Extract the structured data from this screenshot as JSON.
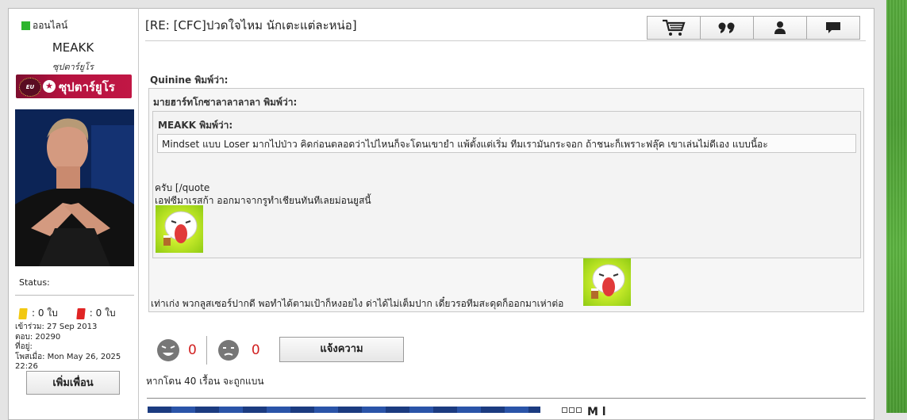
{
  "user": {
    "online_label": "ออนไลน์",
    "username": "MEAKK",
    "rank_title": "ซุปตาร์ยูโร",
    "badge": {
      "emblem": "EU",
      "text": "ซุปตาร์ยูโร"
    },
    "status_label": "Status:",
    "yellow_cards": ": 0 ใบ",
    "red_cards": ": 0 ใบ",
    "joined": "เข้าร่วม: 27 Sep 2013",
    "replies": "ตอบ: 20290",
    "location": "ที่อยู่:",
    "last_post": "โพสเมื่อ: Mon May 26, 2025 22:26",
    "add_friend_label": "เพิ่มเพื่อน"
  },
  "post": {
    "title": "[RE: [CFC]ปวดใจไหม นักเตะแต่ละหน่อ]",
    "toolbar": [
      "cart-icon",
      "quote-icon",
      "user-icon",
      "message-icon"
    ],
    "outer_quote": {
      "author": "Quinine พิมพ์ว่า:",
      "body": "เท่าเก่ง พวกลูสเซอร์ปากดี พอทำได้ตามเป้าก็หงอยไง ด่าได้ไม่เต็มปาก เดี๋ยวรอทีมสะดุดก็ออกมาเห่าต่อ"
    },
    "mid_quote": {
      "author": "มายฮาร์ทโกซาลาลาลาลา พิมพ์ว่า:",
      "line1": "ครับ [/quote",
      "line2": "เอฟซีมาเรสก้า ออกมาจากรูทำเชียนทันทีเลยม่อนยูสนี้"
    },
    "inner_quote": {
      "author": "MEAKK พิมพ์ว่า:",
      "body": "Mindset แบบ Loser มากไปป่าว คิดก่อนตลอดว่าไปไหนก็จะโดนเขายำ แพ้ตั้งแต่เริ่ม ทีมเรามันกระจอก ถ้าชนะก็เพราะฟลุ๊ค เขาเล่นไม่ดีเอง แบบนี้อะ"
    },
    "likes": "0",
    "dislikes": "0",
    "report_label": "แจ้งความ",
    "ban_warning": "หากโดน 40 เรื้อน จะถูกแบน",
    "signature_text": "M  l"
  },
  "colors": {
    "online": "#2db52d",
    "count": "#d12020",
    "badge": "#b5123f",
    "grass": "#4d9f34"
  }
}
